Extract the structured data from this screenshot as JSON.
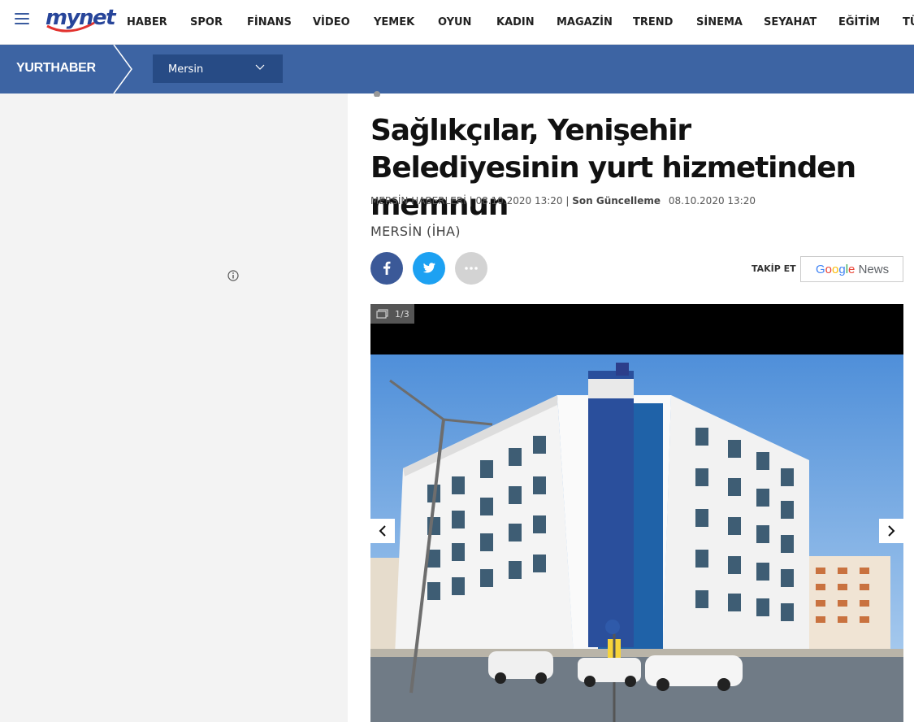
{
  "header": {
    "logo": "mynet",
    "nav": [
      "HABER",
      "SPOR",
      "FİNANS",
      "VİDEO",
      "YEMEK",
      "OYUN",
      "KADIN",
      "MAGAZİN",
      "TREND",
      "SİNEMA",
      "SEYAHAT",
      "EĞİTİM",
      "TÜ"
    ],
    "nav_icons": {
      "menu": "hamburger-menu-icon"
    }
  },
  "subheader": {
    "brand": "YURTHABER",
    "city_select": "Mersin"
  },
  "article": {
    "title": "Sağlıkçılar, Yenişehir Belediyesinin yurt hizmetinden memnun",
    "category": "MERSİN HABERLERİ",
    "published": "08.10.2020 13:20",
    "updated_label": "Son Güncelleme",
    "updated": "08.10.2020 13:20",
    "source": "MERSİN (İHA)"
  },
  "follow": {
    "label": "TAKİP ET",
    "google_news": "News"
  },
  "gallery": {
    "counter": "1/3"
  },
  "colors": {
    "brand_blue": "#3d64a3",
    "select_bg": "#274b85",
    "facebook": "#3b5998",
    "twitter": "#1da1f2"
  }
}
